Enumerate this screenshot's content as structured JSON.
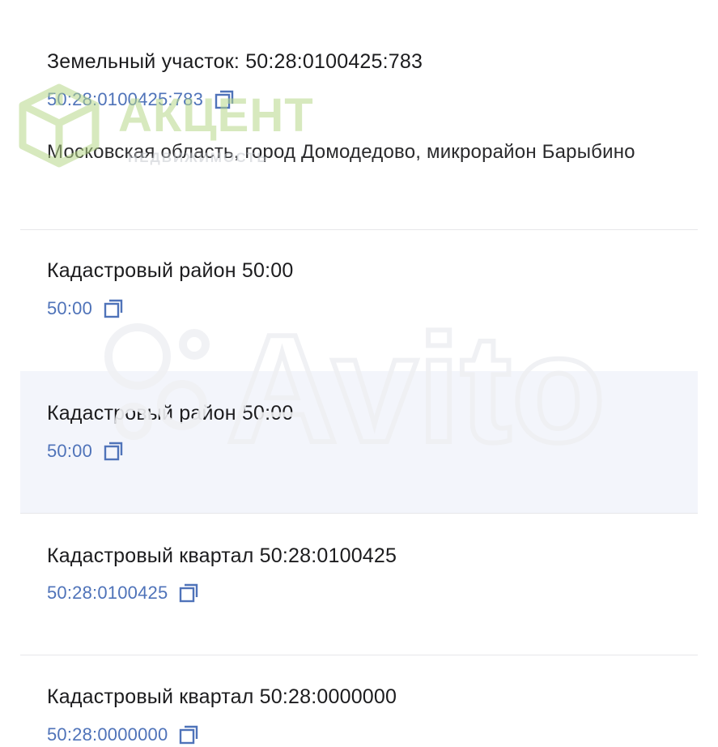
{
  "items": [
    {
      "title": "Земельный участок: 50:28:0100425:783",
      "code": "50:28:0100425:783",
      "address": "Московская область, город Домодедово, микрорайон Барыбино"
    },
    {
      "title": "Кадастровый район 50:00",
      "code": "50:00"
    },
    {
      "title": "Кадастровый район 50:00",
      "code": "50:00"
    },
    {
      "title": "Кадастровый квартал 50:28:0100425",
      "code": "50:28:0100425"
    },
    {
      "title": "Кадастровый квартал 50:28:0000000",
      "code": "50:28:0000000"
    }
  ],
  "watermarks": {
    "akcent_brand": "АКЦЕНТ",
    "akcent_sub": "НЕДВИЖИМОСТЬ",
    "avito_brand": "Avito"
  },
  "colors": {
    "code_link": "#4f73b9",
    "highlight_bg": "#f3f5fb",
    "akcent_green": "#b7d88a"
  },
  "icons": {
    "copy": "copy-icon"
  }
}
